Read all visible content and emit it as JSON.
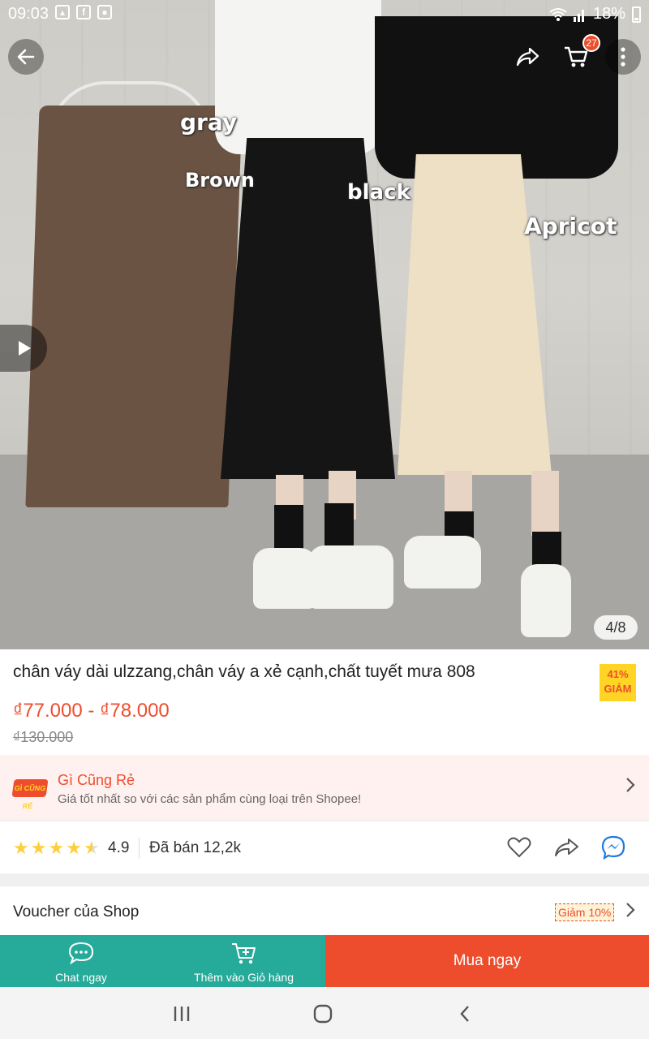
{
  "status_bar": {
    "time": "09:03",
    "battery": "18%"
  },
  "hero": {
    "labels": {
      "gray": "gray",
      "brown": "Brown",
      "black": "black",
      "apricot": "Apricot"
    },
    "image_counter": "4/8",
    "cart_count": "27"
  },
  "product": {
    "title": "chân váy dài ulzzang,chân váy a xẻ cạnh,chất tuyết mưa 808",
    "discount_percent": "41%",
    "discount_label": "GIẢM",
    "price": "₫77.000 - ₫78.000",
    "old_price": "₫130.000"
  },
  "promo": {
    "logo_text": "GÌ CŨNG RẺ",
    "title": "Gì Cũng Rẻ",
    "subtitle": "Giá tốt nhất so với các sản phẩm cùng loại trên Shopee!"
  },
  "rating": {
    "value": "4.9",
    "stars": 4.9,
    "sold": "Đã bán 12,2k"
  },
  "voucher": {
    "label": "Voucher của Shop",
    "tag": "Giảm 10%"
  },
  "bottom_bar": {
    "chat_label": "Chat ngay",
    "cart_label": "Thêm vào Giỏ hàng",
    "buy_label": "Mua ngay"
  },
  "colors": {
    "accent": "#ee4d2d",
    "teal": "#26aa99",
    "star": "#ffce3d"
  }
}
